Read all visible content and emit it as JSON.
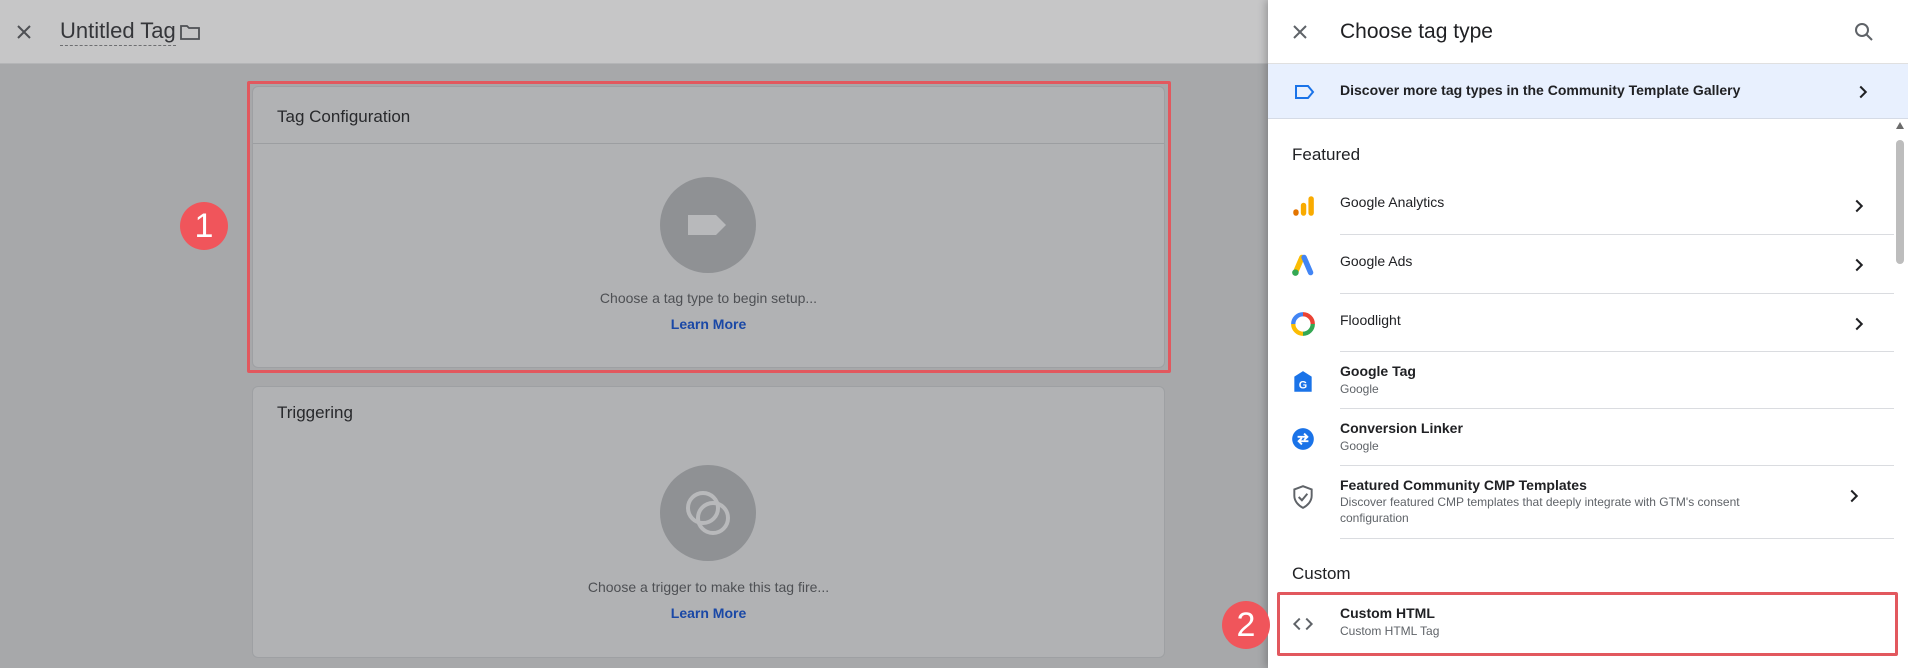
{
  "editor": {
    "title": "Untitled Tag",
    "tag_config": {
      "title": "Tag Configuration",
      "hint": "Choose a tag type to begin setup...",
      "learn_more": "Learn More"
    },
    "triggering": {
      "title": "Triggering",
      "hint": "Choose a trigger to make this tag fire...",
      "learn_more": "Learn More"
    }
  },
  "annotations": {
    "badge1": "1",
    "badge2": "2",
    "color": "#f0555b"
  },
  "panel": {
    "title": "Choose tag type",
    "discover_text": "Discover more tag types in the Community Template Gallery",
    "featured_label": "Featured",
    "custom_label": "Custom",
    "featured": [
      {
        "name": "Google Analytics",
        "icon": "google-analytics-icon"
      },
      {
        "name": "Google Ads",
        "icon": "google-ads-icon"
      },
      {
        "name": "Floodlight",
        "icon": "floodlight-icon"
      },
      {
        "name": "Google Tag",
        "sub": "Google",
        "icon": "google-tag-icon"
      },
      {
        "name": "Conversion Linker",
        "sub": "Google",
        "icon": "conversion-linker-icon"
      },
      {
        "name": "Featured Community CMP Templates",
        "sub": "Discover featured CMP templates that deeply integrate with GTM's consent configuration",
        "icon": "shield-check-icon"
      }
    ],
    "custom": [
      {
        "name": "Custom HTML",
        "sub": "Custom HTML Tag",
        "icon": "code-icon"
      }
    ]
  },
  "colors": {
    "accent_blue": "#1a73e8",
    "discover_bg": "#e8f0fe",
    "annotation_red": "#e2585e"
  }
}
